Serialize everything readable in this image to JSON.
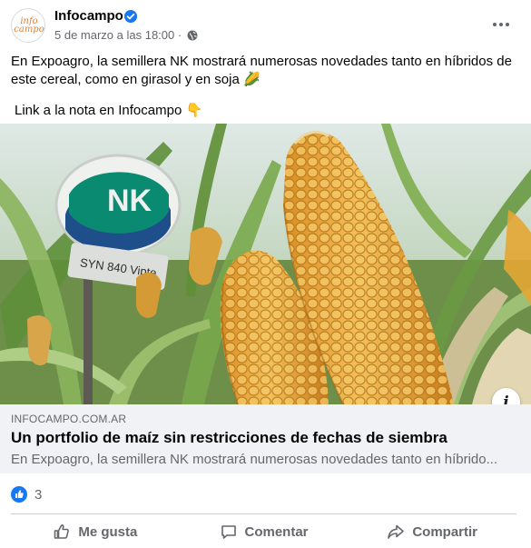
{
  "post": {
    "page_name": "Infocampo",
    "avatar_text": "info campo",
    "timestamp": "5 de marzo a las 18:00 ·",
    "verified_icon": "verified-badge-icon",
    "privacy_icon": "globe-icon",
    "more_icon": "more-options-icon",
    "text_line1": "En Expoagro, la semillera NK mostrará numerosas novedades tanto en híbridos de este cereal, como en girasol y en soja 🌽",
    "text_line2": "Link a la nota en Infocampo 👇",
    "image_sign": "NK",
    "image_tag": "SYN 840 Vipte"
  },
  "link_preview": {
    "domain": "INFOCAMPO.COM.AR",
    "title": "Un portfolio de maíz sin restricciones de fechas de siembra",
    "description": "En Expoagro, la semillera NK mostrará numerosas novedades tanto en híbrido...",
    "info_label": "i"
  },
  "reactions": {
    "icon": "like-reaction-icon",
    "count": "3"
  },
  "actions": {
    "like": "Me gusta",
    "comment": "Comentar",
    "share": "Compartir"
  },
  "colors": {
    "facebook_blue": "#1877f2",
    "secondary_text": "#65676b",
    "preview_bg": "#f0f2f5"
  }
}
